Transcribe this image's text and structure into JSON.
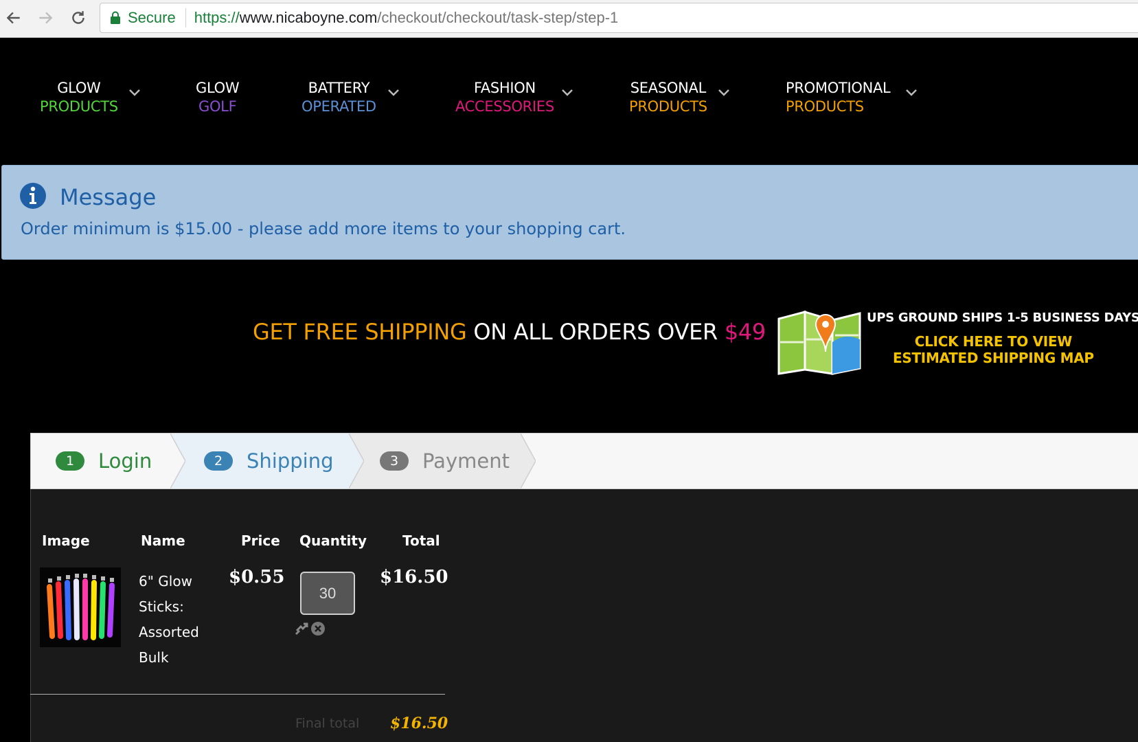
{
  "browser": {
    "secure_label": "Secure",
    "url_scheme": "https://",
    "url_host": "www.nicaboyne.com",
    "url_path": "/checkout/checkout/task-step/step-1"
  },
  "nav": {
    "items": [
      {
        "line1": "GLOW",
        "line2": "PRODUCTS",
        "color": "#52d63a"
      },
      {
        "line1": "GLOW",
        "line2": "GOLF",
        "color": "#8a4fd1"
      },
      {
        "line1": "BATTERY",
        "line2": "OPERATED",
        "color": "#5b8fd6"
      },
      {
        "line1": "FASHION",
        "line2": "ACCESSORIES",
        "color": "#e0177c"
      },
      {
        "line1": "SEASONAL",
        "line2": "PRODUCTS",
        "color": "#f3a000"
      },
      {
        "line1": "PROMOTIONAL",
        "line2": "PRODUCTS",
        "color": "#f3a000"
      }
    ]
  },
  "message": {
    "title": "Message",
    "text": "Order minimum is $15.00 - please add more items to your shopping cart."
  },
  "shipping_banner": {
    "part1": "GET FREE SHIPPING",
    "part2": " ON ALL ORDERS OVER ",
    "part3": "$49",
    "ups_line": "UPS GROUND SHIPS 1-5 BUSINESS DAYS",
    "click_line1": "CLICK HERE TO VIEW",
    "click_line2": "ESTIMATED SHIPPING MAP"
  },
  "steps": [
    {
      "num": "1",
      "label": "Login",
      "color": "#2f8a3e"
    },
    {
      "num": "2",
      "label": "Shipping",
      "color": "#3b82b5"
    },
    {
      "num": "3",
      "label": "Payment",
      "color": "#777777"
    }
  ],
  "cart": {
    "headers": {
      "image": "Image",
      "name": "Name",
      "price": "Price",
      "quantity": "Quantity",
      "total": "Total"
    },
    "item": {
      "name": "6\" Glow Sticks: Assorted Bulk",
      "price": "$0.55",
      "quantity": "30",
      "total": "$16.50"
    },
    "final_label": "Final total",
    "final_total": "$16.50"
  },
  "colors": {
    "accent_orange": "#f3a000",
    "accent_pink": "#e0177c",
    "message_bg": "#a9c5e0",
    "message_text": "#1f5fa6"
  }
}
